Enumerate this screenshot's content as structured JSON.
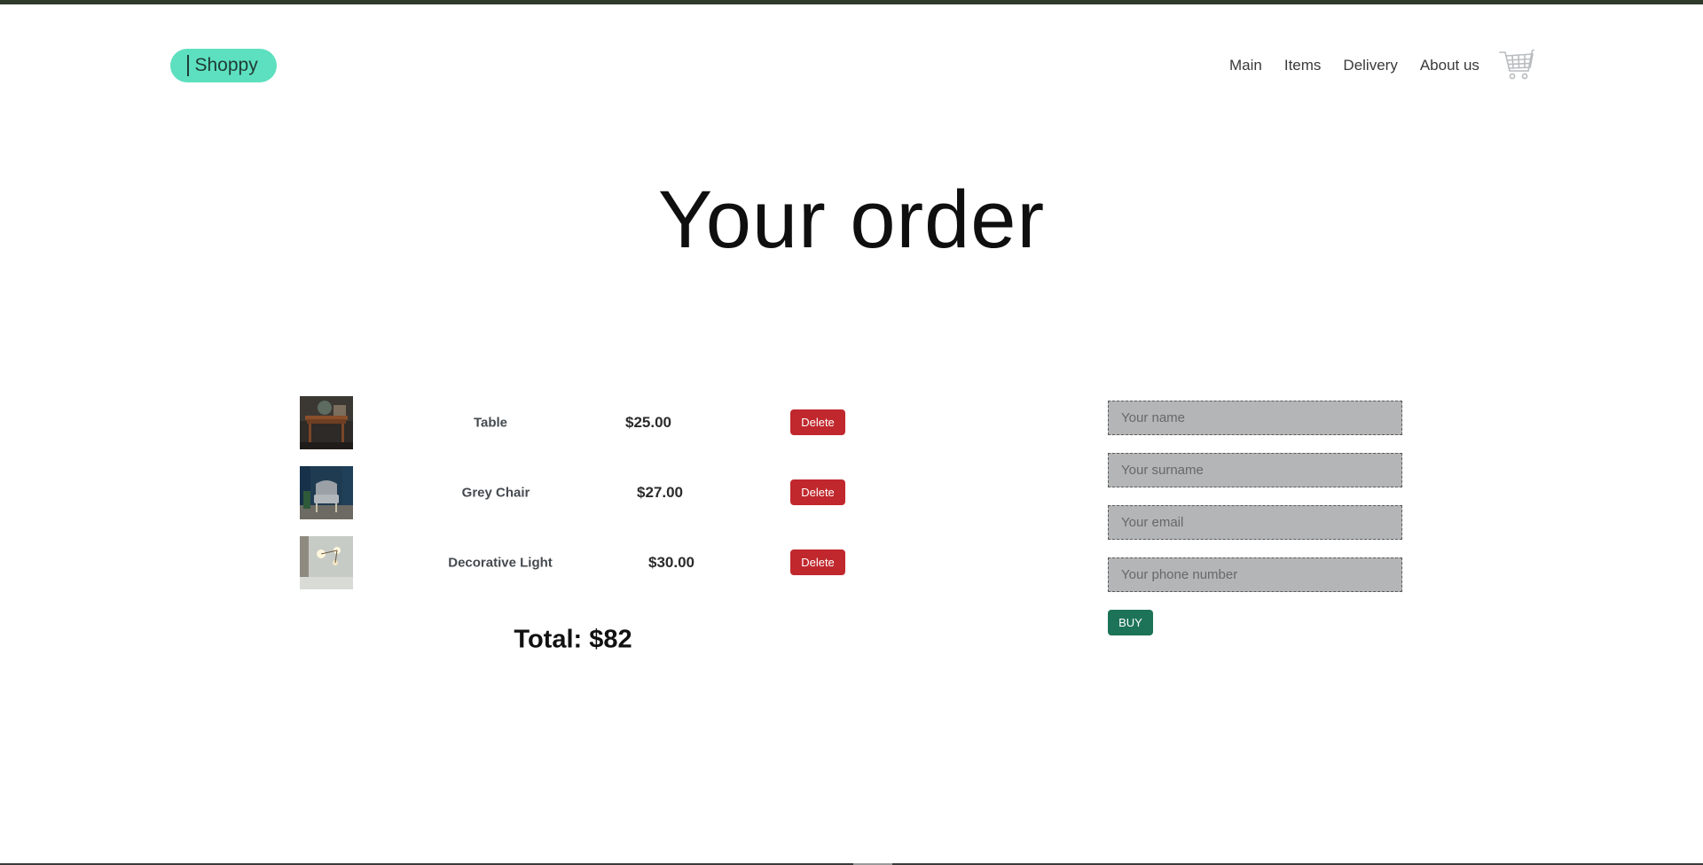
{
  "header": {
    "logo_text": "Shoppy",
    "nav": [
      {
        "label": "Main"
      },
      {
        "label": "Items"
      },
      {
        "label": "Delivery"
      },
      {
        "label": "About us"
      }
    ],
    "cart_icon": "shopping-cart-icon"
  },
  "main": {
    "title": "Your order",
    "items": [
      {
        "name": "Table",
        "price": "$25.00",
        "delete_label": "Delete",
        "image": "table-photo"
      },
      {
        "name": "Grey Chair",
        "price": "$27.00",
        "delete_label": "Delete",
        "image": "grey-chair-photo"
      },
      {
        "name": "Decorative Light",
        "price": "$30.00",
        "delete_label": "Delete",
        "image": "decorative-light-photo"
      }
    ],
    "total": "Total: $82"
  },
  "form": {
    "name_placeholder": "Your name",
    "surname_placeholder": "Your surname",
    "email_placeholder": "Your email",
    "phone_placeholder": "Your phone number",
    "buy_label": "BUY"
  },
  "colors": {
    "logo_bg": "#5de0bf",
    "delete_bg": "#c0282d",
    "buy_bg": "#1d7357",
    "field_bg": "#b4b5b7",
    "top_strip": "#2f3a2c"
  }
}
